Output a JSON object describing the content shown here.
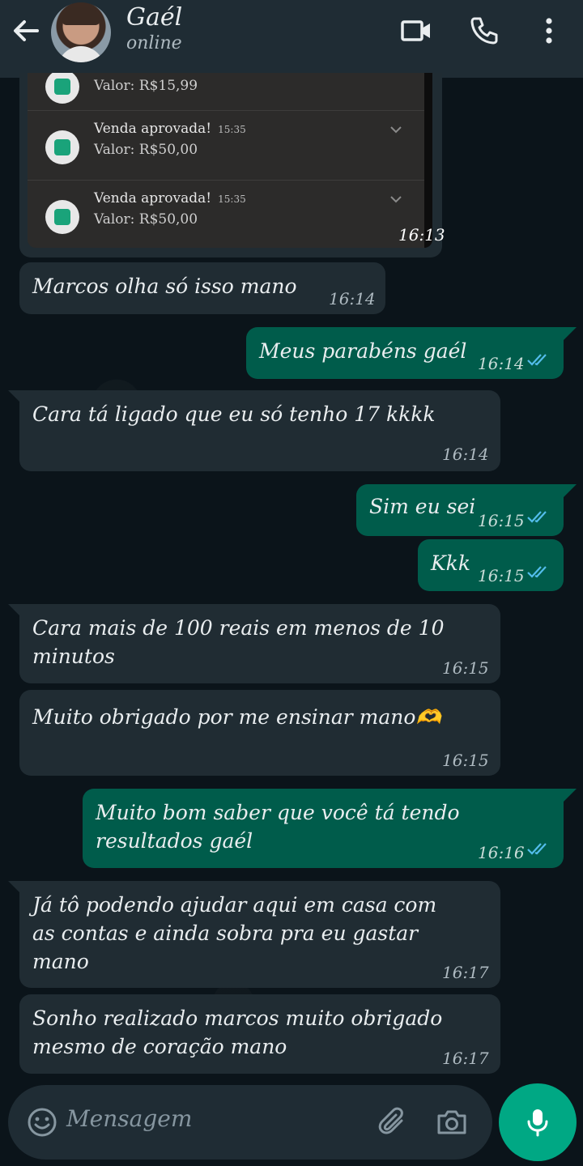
{
  "header": {
    "name": "Gaél",
    "status": "online"
  },
  "screenshot_image": {
    "notifications": [
      {
        "title": "",
        "time": "",
        "value": "Valor: R$15,99"
      },
      {
        "title": "Venda aprovada!",
        "time": "15:35",
        "value": "Valor: R$50,00"
      },
      {
        "title": "Venda aprovada!",
        "time": "15:35",
        "value": "Valor: R$50,00"
      }
    ],
    "time": "16:13"
  },
  "messages": [
    {
      "direction": "in",
      "lines": [
        "Marcos olha só isso mano"
      ],
      "time": "16:14"
    },
    {
      "direction": "out",
      "lines": [
        "Meus parabéns gaél"
      ],
      "time": "16:14"
    },
    {
      "direction": "in",
      "lines": [
        "Cara tá ligado que eu só tenho 17 kkkk"
      ],
      "time": "16:14"
    },
    {
      "direction": "out",
      "lines": [
        "Sim eu sei"
      ],
      "time": "16:15"
    },
    {
      "direction": "out",
      "lines": [
        "Kkk"
      ],
      "time": "16:15"
    },
    {
      "direction": "in",
      "lines": [
        "Cara mais de 100 reais em menos de 10",
        "minutos"
      ],
      "time": "16:15"
    },
    {
      "direction": "in",
      "lines": [
        "Muito obrigado por me ensinar mano🫶"
      ],
      "time": "16:15"
    },
    {
      "direction": "out",
      "lines": [
        "Muito bom saber que você tá tendo",
        "resultados gaél"
      ],
      "time": "16:16"
    },
    {
      "direction": "in",
      "lines": [
        "Já tô podendo ajudar aqui em casa com",
        "as contas e ainda sobra pra eu gastar",
        "mano"
      ],
      "time": "16:17"
    },
    {
      "direction": "in",
      "lines": [
        "Sonho realizado marcos muito obrigado",
        "mesmo de coração mano"
      ],
      "time": "16:17"
    }
  ],
  "input": {
    "placeholder": "Mensagem"
  },
  "colors": {
    "incoming": "#202c33",
    "outgoing": "#005c4b",
    "accent": "#00a884",
    "read_ticks": "#53bdeb"
  }
}
